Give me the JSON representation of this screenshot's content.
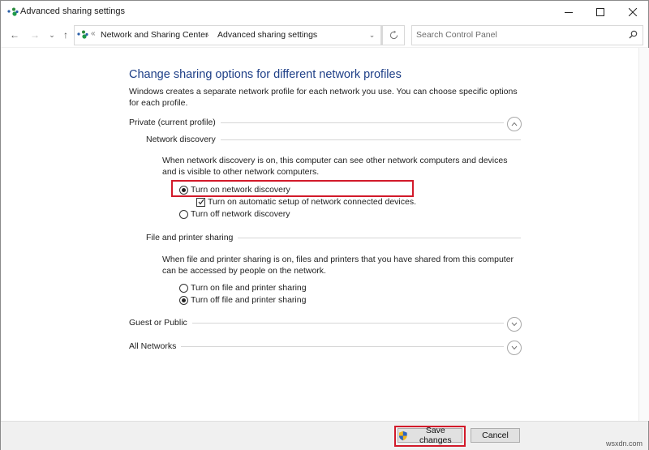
{
  "window": {
    "title": "Advanced sharing settings",
    "controls": {
      "minimize": "—",
      "maximize": "☐",
      "close": "✕"
    }
  },
  "nav": {
    "back": "←",
    "forward": "→",
    "recent": "⌄",
    "up": "↑",
    "breadcrumb_overflow": "«",
    "breadcrumbs": [
      "Network and Sharing Center",
      "Advanced sharing settings"
    ],
    "breadcrumb_separator": "›",
    "dropdown": "⌄",
    "refresh": "↻",
    "search_placeholder": "Search Control Panel"
  },
  "main": {
    "title": "Change sharing options for different network profiles",
    "intro": "Windows creates a separate network profile for each network you use. You can choose specific options for each profile.",
    "profiles": [
      {
        "label": "Private (current profile)",
        "expanded": true,
        "sections": [
          {
            "label": "Network discovery",
            "description": "When network discovery is on, this computer can see other network computers and devices and is visible to other network computers.",
            "options": [
              {
                "label": "Turn on network discovery",
                "type": "radio",
                "selected": true,
                "highlighted": true
              },
              {
                "label": "Turn on automatic setup of network connected devices.",
                "type": "checkbox",
                "checked": true
              },
              {
                "label": "Turn off network discovery",
                "type": "radio",
                "selected": false
              }
            ]
          },
          {
            "label": "File and printer sharing",
            "description": "When file and printer sharing is on, files and printers that you have shared from this computer can be accessed by people on the network.",
            "options": [
              {
                "label": "Turn on file and printer sharing",
                "type": "radio",
                "selected": false
              },
              {
                "label": "Turn off file and printer sharing",
                "type": "radio",
                "selected": true
              }
            ]
          }
        ]
      },
      {
        "label": "Guest or Public",
        "expanded": false
      },
      {
        "label": "All Networks",
        "expanded": false
      }
    ]
  },
  "footer": {
    "save_label": "Save changes",
    "cancel_label": "Cancel",
    "watermark": "wsxdn.com"
  },
  "colors": {
    "title_blue": "#1e3f87",
    "highlight_red": "#d21a2a"
  }
}
